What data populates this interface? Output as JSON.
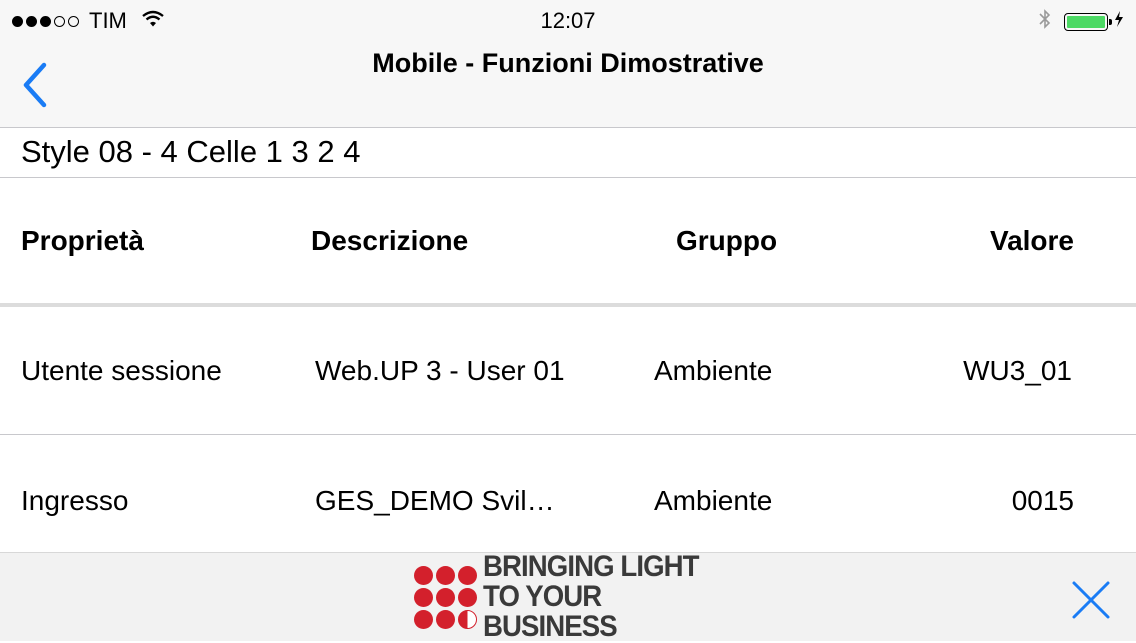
{
  "status_bar": {
    "carrier": "TIM",
    "signal_bars_filled": 3,
    "signal_bars_total": 5,
    "time": "12:07",
    "battery_level": 1.0,
    "icons": [
      "wifi-icon",
      "bluetooth-icon",
      "battery-icon",
      "charging-icon"
    ]
  },
  "nav": {
    "title": "Mobile - Funzioni Dimostrative",
    "back_icon": "chevron-left-icon",
    "accent_color": "#1a7cf5"
  },
  "style_title": "Style 08 - 4 Celle 1 3 2 4",
  "table": {
    "headers": [
      "Proprietà",
      "Descrizione",
      "Gruppo",
      "Valore"
    ],
    "rows": [
      [
        "Utente sessione",
        "Web.UP 3 - User 01",
        "Ambiente",
        "WU3_01"
      ],
      [
        "Ingresso",
        "GES_DEMO  Svil…",
        "Ambiente",
        "0015"
      ]
    ]
  },
  "footer": {
    "banner_line1": "BRINGING LIGHT",
    "banner_line2": "TO YOUR BUSINESS",
    "banner_color": "#d3202c",
    "close_icon": "close-icon"
  }
}
